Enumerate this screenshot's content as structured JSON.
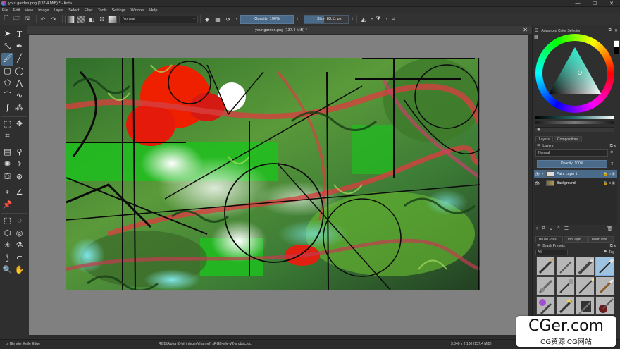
{
  "window": {
    "title": "your garden.png (137.4 MiB) * - Krita",
    "min": "—",
    "max": "☐",
    "close": "✕"
  },
  "menu": [
    "File",
    "Edit",
    "View",
    "Image",
    "Layer",
    "Select",
    "Filter",
    "Tools",
    "Settings",
    "Window",
    "Help"
  ],
  "toolbar": {
    "blend_mode": "Normal",
    "opacity": "Opacity: 100%",
    "size": "Size: 83.11 px"
  },
  "document": {
    "tab_title": "your garden.png (137.4 MiB) *",
    "close": "✕"
  },
  "dock": {
    "color_selector_title": "Advanced Color Selector",
    "tabs_layers": [
      "Layers",
      "Compositions"
    ],
    "layers_title": "Layers",
    "layer_blend": "Normal",
    "layer_opacity": "Opacity: 100%",
    "layers": [
      {
        "name": "Paint Layer 1",
        "selected": true
      },
      {
        "name": "Background",
        "selected": false
      }
    ],
    "tabs_bottom": [
      "Brush Pres...",
      "Tool Opti...",
      "Undo Hist..."
    ],
    "presets_title": "Brush Presets",
    "presets_filter": "All",
    "presets_tag": "Tag"
  },
  "status": {
    "brush": "b) Blender Knife Edge",
    "color": "RGB/Alpha (8-bit integer/channel)  sRGB-elle-V2-srgbtrc.icc",
    "size": "3,840 x 2,160 (137.4 MiB)"
  },
  "watermark": {
    "big": "CGer.com",
    "small": "CG资源  CG网站"
  },
  "colors": {
    "accent": "#4a6a8a",
    "canvas_bg": "#808080",
    "panel_bg": "#2f2f2f"
  }
}
